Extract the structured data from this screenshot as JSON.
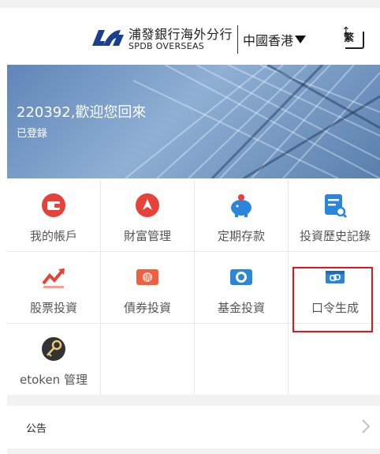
{
  "header": {
    "brand_cn": "浦發銀行海外分行",
    "brand_en": "SPDB OVERSEAS",
    "region": "中國香港",
    "lang_label": "繁"
  },
  "banner": {
    "welcome": "220392,歡迎您回來",
    "status": "已登錄"
  },
  "grid": {
    "items": [
      {
        "label": "我的帳戶",
        "icon": "wallet-icon",
        "color": "#e8413a"
      },
      {
        "label": "財富管理",
        "icon": "wealth-icon",
        "color": "#e8413a"
      },
      {
        "label": "定期存款",
        "icon": "piggy-bank-icon",
        "color": "#2b86d9"
      },
      {
        "label": "投資歷史記錄",
        "icon": "history-search-icon",
        "color": "#2b86d9"
      },
      {
        "label": "股票投資",
        "icon": "stock-chart-icon",
        "color": "#e8413a"
      },
      {
        "label": "債券投資",
        "icon": "bond-icon",
        "color": "#f06040"
      },
      {
        "label": "基金投資",
        "icon": "fund-icon",
        "color": "#2b86d9"
      },
      {
        "label": "口令生成",
        "icon": "token-generate-icon",
        "color": "#2b86d9"
      },
      {
        "label": "etoken 管理",
        "icon": "key-icon",
        "color": "#333333"
      }
    ]
  },
  "notice": {
    "label": "公告"
  }
}
